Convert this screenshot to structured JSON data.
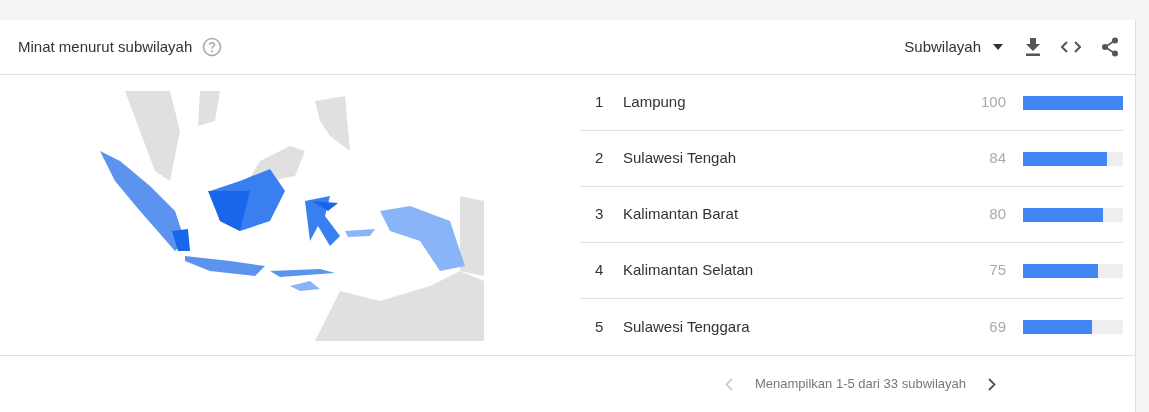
{
  "card": {
    "title": "Minat menurut subwilayah",
    "dropdown": {
      "value": "Subwilayah"
    }
  },
  "rows": [
    {
      "rank": "1",
      "name": "Lampung",
      "value": "100",
      "level": 1.0
    },
    {
      "rank": "2",
      "name": "Sulawesi Tengah",
      "value": "84",
      "level": 0.84
    },
    {
      "rank": "3",
      "name": "Kalimantan Barat",
      "value": "80",
      "level": 0.8
    },
    {
      "rank": "4",
      "name": "Kalimantan Selatan",
      "value": "75",
      "level": 0.75
    },
    {
      "rank": "5",
      "name": "Sulawesi Tenggara",
      "value": "69",
      "level": 0.69
    }
  ],
  "pager": {
    "text": "Menampilkan 1-5 dari 33 subwilayah",
    "previous": {
      "disabled": true
    },
    "next": {
      "disabled": false
    }
  }
}
